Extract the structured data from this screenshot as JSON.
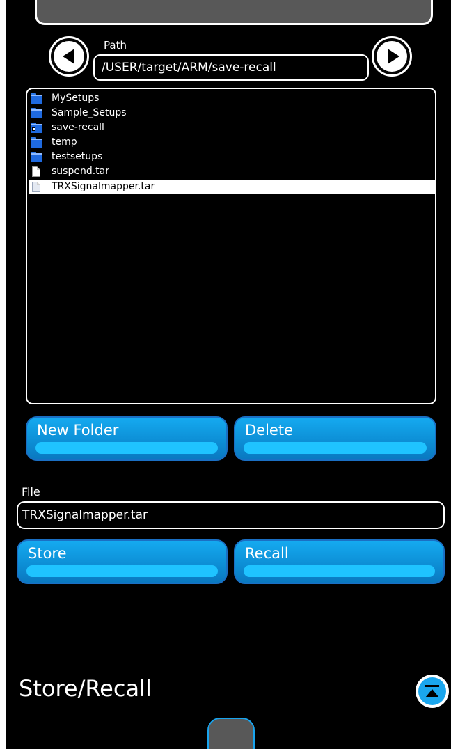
{
  "path": {
    "label": "Path",
    "value": "/USER/target/ARM/save-recall"
  },
  "file_browser": {
    "items": [
      {
        "name": "MySetups",
        "type": "folder"
      },
      {
        "name": "Sample_Setups",
        "type": "folder"
      },
      {
        "name": "save-recall",
        "type": "folder"
      },
      {
        "name": "temp",
        "type": "folder"
      },
      {
        "name": "testsetups",
        "type": "folder"
      },
      {
        "name": "suspend.tar",
        "type": "file"
      },
      {
        "name": "TRXSignalmapper.tar",
        "type": "file",
        "selected": true
      }
    ]
  },
  "actions": {
    "new_folder": "New Folder",
    "delete": "Delete",
    "store": "Store",
    "recall": "Recall"
  },
  "file": {
    "label": "File",
    "value": "TRXSignalmapper.tar"
  },
  "screen": {
    "title": "Store/Recall"
  },
  "colors": {
    "background": "#000000",
    "button_blue": "#0d8fd6",
    "button_highlight": "#1fc3ff",
    "folder_blue": "#1f6ae0",
    "selection": "#ffffff"
  },
  "icons": {
    "back": "left-arrow-icon",
    "forward": "right-arrow-icon",
    "folder": "folder-icon",
    "file": "document-icon",
    "collapse": "collapse-up-icon"
  }
}
